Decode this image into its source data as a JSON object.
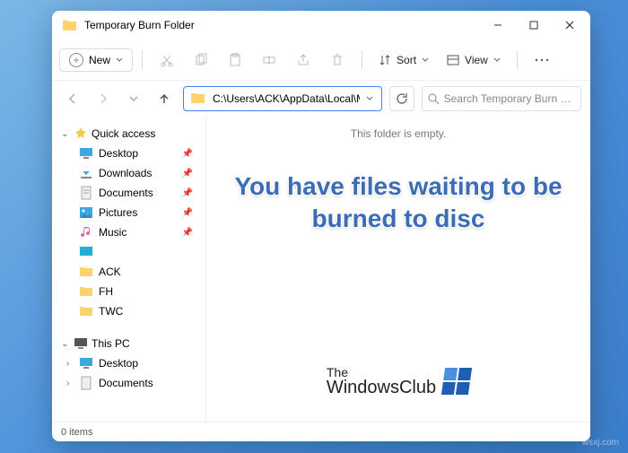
{
  "titlebar": {
    "title": "Temporary Burn Folder"
  },
  "toolbar": {
    "new_label": "New",
    "sort_label": "Sort",
    "view_label": "View"
  },
  "addressbar": {
    "path": "C:\\Users\\ACK\\AppData\\Local\\Microsoft\\Windows\\Burn\\Burn",
    "search_placeholder": "Search Temporary Burn Folder"
  },
  "sidebar": {
    "quick_access": {
      "label": "Quick access",
      "items": [
        {
          "label": "Desktop",
          "pinned": true
        },
        {
          "label": "Downloads",
          "pinned": true
        },
        {
          "label": "Documents",
          "pinned": true
        },
        {
          "label": "Pictures",
          "pinned": true
        },
        {
          "label": "Music",
          "pinned": true
        },
        {
          "label": "ACK",
          "pinned": false
        },
        {
          "label": "FH",
          "pinned": false
        },
        {
          "label": "TWC",
          "pinned": false
        }
      ]
    },
    "this_pc": {
      "label": "This PC",
      "items": [
        {
          "label": "Desktop"
        },
        {
          "label": "Documents"
        }
      ]
    }
  },
  "content": {
    "empty_message": "This folder is empty."
  },
  "statusbar": {
    "items_label": "0 items"
  },
  "overlay": {
    "headline": "You have files waiting to be burned to disc",
    "brand_top": "The",
    "brand_bottom": "WindowsClub"
  },
  "watermark": "wsxj.com"
}
